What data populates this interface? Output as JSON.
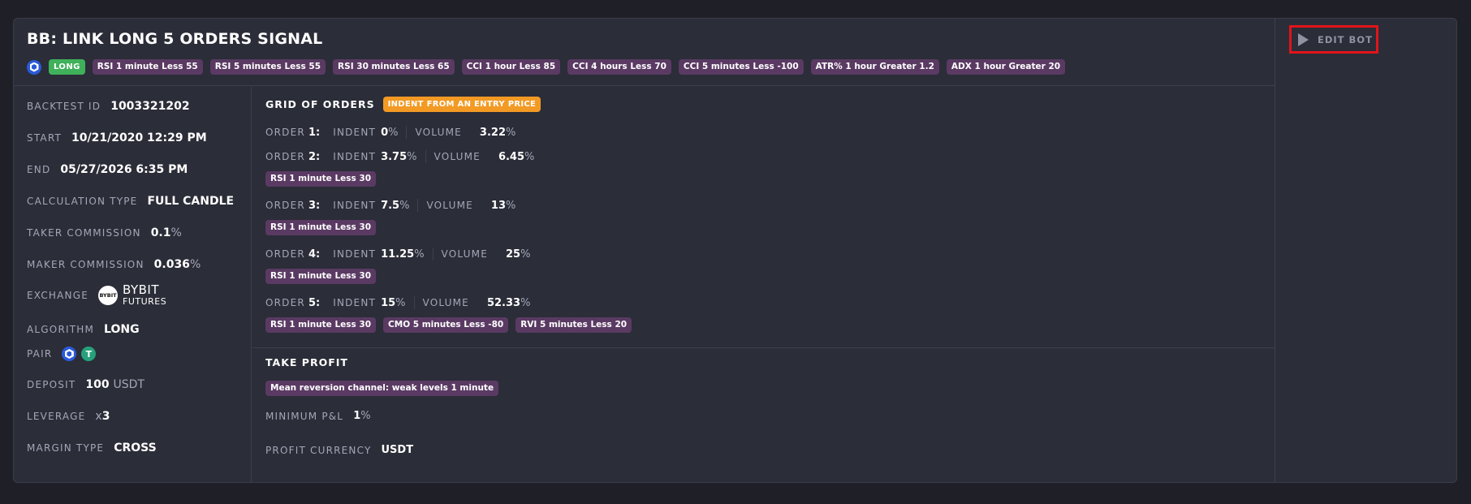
{
  "bot": {
    "title": "BB: LINK LONG 5 ORDERS SIGNAL",
    "direction_tag": "LONG",
    "signal_tags": [
      "RSI 1 minute Less 55",
      "RSI 5 minutes Less 55",
      "RSI 30 minutes Less 65",
      "CCI 1 hour Less 85",
      "CCI 4 hours Less 70",
      "CCI 5 minutes Less -100",
      "ATR% 1 hour Greater 1.2",
      "ADX 1 hour Greater 20"
    ]
  },
  "details": {
    "backtest_id_label": "BACKTEST ID",
    "backtest_id": "1003321202",
    "start_label": "START",
    "start": "10/21/2020 12:29 PM",
    "end_label": "END",
    "end": "05/27/2026 6:35 PM",
    "calc_type_label": "CALCULATION TYPE",
    "calc_type": "FULL CANDLE",
    "taker_label": "TAKER COMMISSION",
    "taker": "0.1",
    "maker_label": "MAKER COMMISSION",
    "maker": "0.036",
    "pct": "%",
    "exchange_label": "EXCHANGE",
    "exchange_logo_text": "BYBIT",
    "exchange_name": "BYBIT",
    "exchange_sub": "FUTURES",
    "algorithm_label": "ALGORITHM",
    "algorithm": "LONG",
    "pair_label": "PAIR",
    "usdt_icon_glyph": "T",
    "deposit_label": "DEPOSIT",
    "deposit": "100",
    "deposit_unit": "USDT",
    "leverage_label": "LEVERAGE",
    "leverage_prefix": "x",
    "leverage": "3",
    "margin_label": "MARGIN TYPE",
    "margin": "CROSS"
  },
  "grid": {
    "title": "GRID OF ORDERS",
    "badge": "INDENT FROM AN ENTRY PRICE",
    "order_label": "ORDER",
    "indent_label": "INDENT",
    "volume_label": "VOLUME",
    "pct": "%",
    "orders": [
      {
        "num": "1:",
        "indent": "0",
        "volume": "3.22",
        "tags": []
      },
      {
        "num": "2:",
        "indent": "3.75",
        "volume": "6.45",
        "tags": [
          "RSI 1 minute Less 30"
        ]
      },
      {
        "num": "3:",
        "indent": "7.5",
        "volume": "13",
        "tags": [
          "RSI 1 minute Less 30"
        ]
      },
      {
        "num": "4:",
        "indent": "11.25",
        "volume": "25",
        "tags": [
          "RSI 1 minute Less 30"
        ]
      },
      {
        "num": "5:",
        "indent": "15",
        "volume": "52.33",
        "tags": [
          "RSI 1 minute Less 30",
          "CMO 5 minutes Less -80",
          "RVI 5 minutes Less 20"
        ]
      }
    ]
  },
  "take_profit": {
    "title": "TAKE PROFIT",
    "tag": "Mean reversion channel: weak levels 1 minute",
    "min_pnl_label": "MINIMUM P&L",
    "min_pnl": "1",
    "pct": "%",
    "currency_label": "PROFIT CURRENCY",
    "currency": "USDT"
  },
  "actions": {
    "edit_bot": "EDIT BOT"
  },
  "colors": {
    "background": "#1f2027",
    "card": "#2b2d38",
    "tag_purple": "#5a3a63",
    "tag_green": "#3fb15a",
    "tag_orange": "#f29a24",
    "highlight_red": "#e1141a"
  },
  "icons": {
    "coin_link": "chainlink-hex-icon",
    "coin_usdt": "tether-icon",
    "exchange": "bybit-logo-icon",
    "edit": "play-icon"
  }
}
